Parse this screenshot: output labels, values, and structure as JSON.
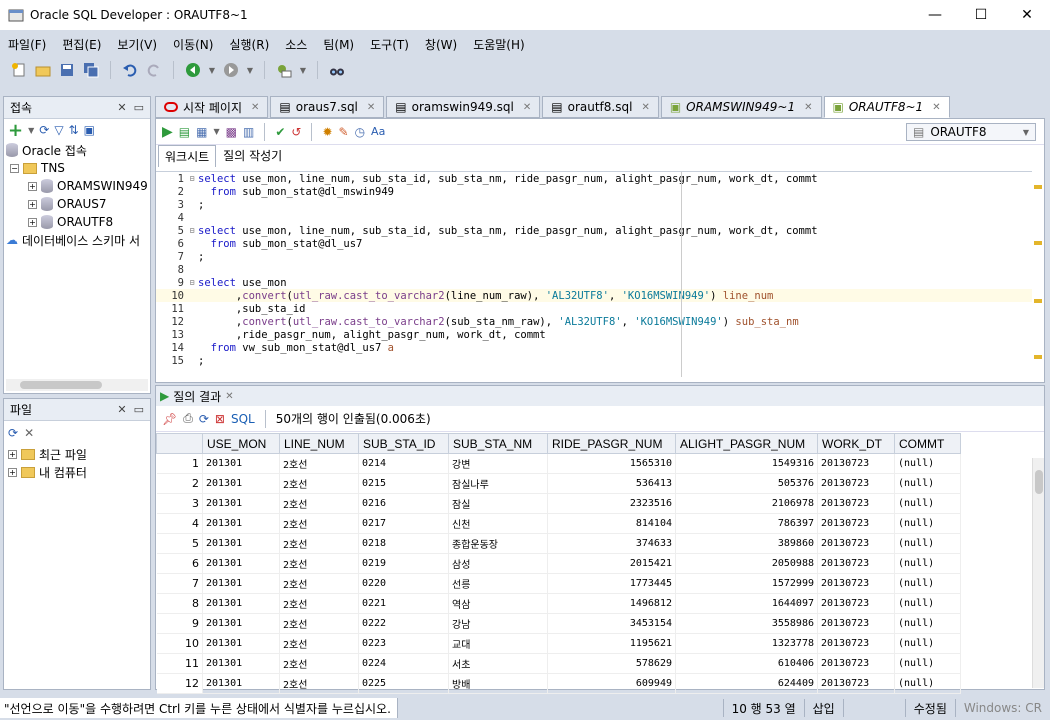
{
  "window": {
    "title": "Oracle SQL Developer : ORAUTF8~1",
    "minimize": "—",
    "maximize": "☐",
    "close": "✕"
  },
  "menu": [
    "파일(F)",
    "편집(E)",
    "보기(V)",
    "이동(N)",
    "실행(R)",
    "소스",
    "팀(M)",
    "도구(T)",
    "창(W)",
    "도움말(H)"
  ],
  "connections": {
    "title": "접속",
    "items": [
      "Oracle 접속",
      "TNS",
      "ORAMSWIN949",
      "ORAUS7",
      "ORAUTF8",
      "데이터베이스 스키마 서"
    ]
  },
  "files": {
    "title": "파일",
    "items": [
      "최근 파일",
      "내 컴퓨터"
    ]
  },
  "tabs": [
    "시작 페이지",
    "oraus7.sql",
    "oramswin949.sql",
    "orautf8.sql",
    "ORAMSWIN949~1",
    "ORAUTF8~1"
  ],
  "editor": {
    "connection": "ORAUTF8",
    "subtabs": [
      "워크시트",
      "질의 작성기"
    ]
  },
  "code_lines": [
    "select use_mon, line_num, sub_sta_id, sub_sta_nm, ride_pasgr_num, alight_pasgr_num, work_dt, commt",
    "  from sub_mon_stat@dl_mswin949",
    ";",
    "",
    "select use_mon, line_num, sub_sta_id, sub_sta_nm, ride_pasgr_num, alight_pasgr_num, work_dt, commt",
    "  from sub_mon_stat@dl_us7",
    ";",
    "",
    "select use_mon",
    "      ,convert(utl_raw.cast_to_varchar2(line_num_raw), 'AL32UTF8', 'KO16MSWIN949') line_num",
    "      ,sub_sta_id",
    "      ,convert(utl_raw.cast_to_varchar2(sub_sta_nm_raw), 'AL32UTF8', 'KO16MSWIN949') sub_sta_nm",
    "      ,ride_pasgr_num, alight_pasgr_num, work_dt, commt",
    "  from vw_sub_mon_stat@dl_us7 a",
    ";"
  ],
  "results": {
    "tab": "질의 결과",
    "sql_label": "SQL",
    "summary": "50개의 행이 인출됨(0.006초)",
    "columns": [
      "USE_MON",
      "LINE_NUM",
      "SUB_STA_ID",
      "SUB_STA_NM",
      "RIDE_PASGR_NUM",
      "ALIGHT_PASGR_NUM",
      "WORK_DT",
      "COMMT"
    ],
    "rows": [
      [
        "1",
        "201301",
        "2호선",
        "0214",
        "강변",
        "1565310",
        "1549316",
        "20130723",
        "(null)"
      ],
      [
        "2",
        "201301",
        "2호선",
        "0215",
        "잠실나루",
        "536413",
        "505376",
        "20130723",
        "(null)"
      ],
      [
        "3",
        "201301",
        "2호선",
        "0216",
        "잠실",
        "2323516",
        "2106978",
        "20130723",
        "(null)"
      ],
      [
        "4",
        "201301",
        "2호선",
        "0217",
        "신천",
        "814104",
        "786397",
        "20130723",
        "(null)"
      ],
      [
        "5",
        "201301",
        "2호선",
        "0218",
        "종합운동장",
        "374633",
        "389860",
        "20130723",
        "(null)"
      ],
      [
        "6",
        "201301",
        "2호선",
        "0219",
        "삼성",
        "2015421",
        "2050988",
        "20130723",
        "(null)"
      ],
      [
        "7",
        "201301",
        "2호선",
        "0220",
        "선릉",
        "1773445",
        "1572999",
        "20130723",
        "(null)"
      ],
      [
        "8",
        "201301",
        "2호선",
        "0221",
        "역삼",
        "1496812",
        "1644097",
        "20130723",
        "(null)"
      ],
      [
        "9",
        "201301",
        "2호선",
        "0222",
        "강남",
        "3453154",
        "3558986",
        "20130723",
        "(null)"
      ],
      [
        "10",
        "201301",
        "2호선",
        "0223",
        "교대",
        "1195621",
        "1323778",
        "20130723",
        "(null)"
      ],
      [
        "11",
        "201301",
        "2호선",
        "0224",
        "서초",
        "578629",
        "610406",
        "20130723",
        "(null)"
      ],
      [
        "12",
        "201301",
        "2호선",
        "0225",
        "방배",
        "609949",
        "624409",
        "20130723",
        "(null)"
      ]
    ]
  },
  "status": {
    "message": "\"선언으로 이동\"을 수행하려면 Ctrl 키를 누른 상태에서 식별자를 누르십시오.",
    "position": "10 행 53 열",
    "mode": "삽입",
    "modified": "수정됨",
    "platform": "Windows: CR"
  }
}
